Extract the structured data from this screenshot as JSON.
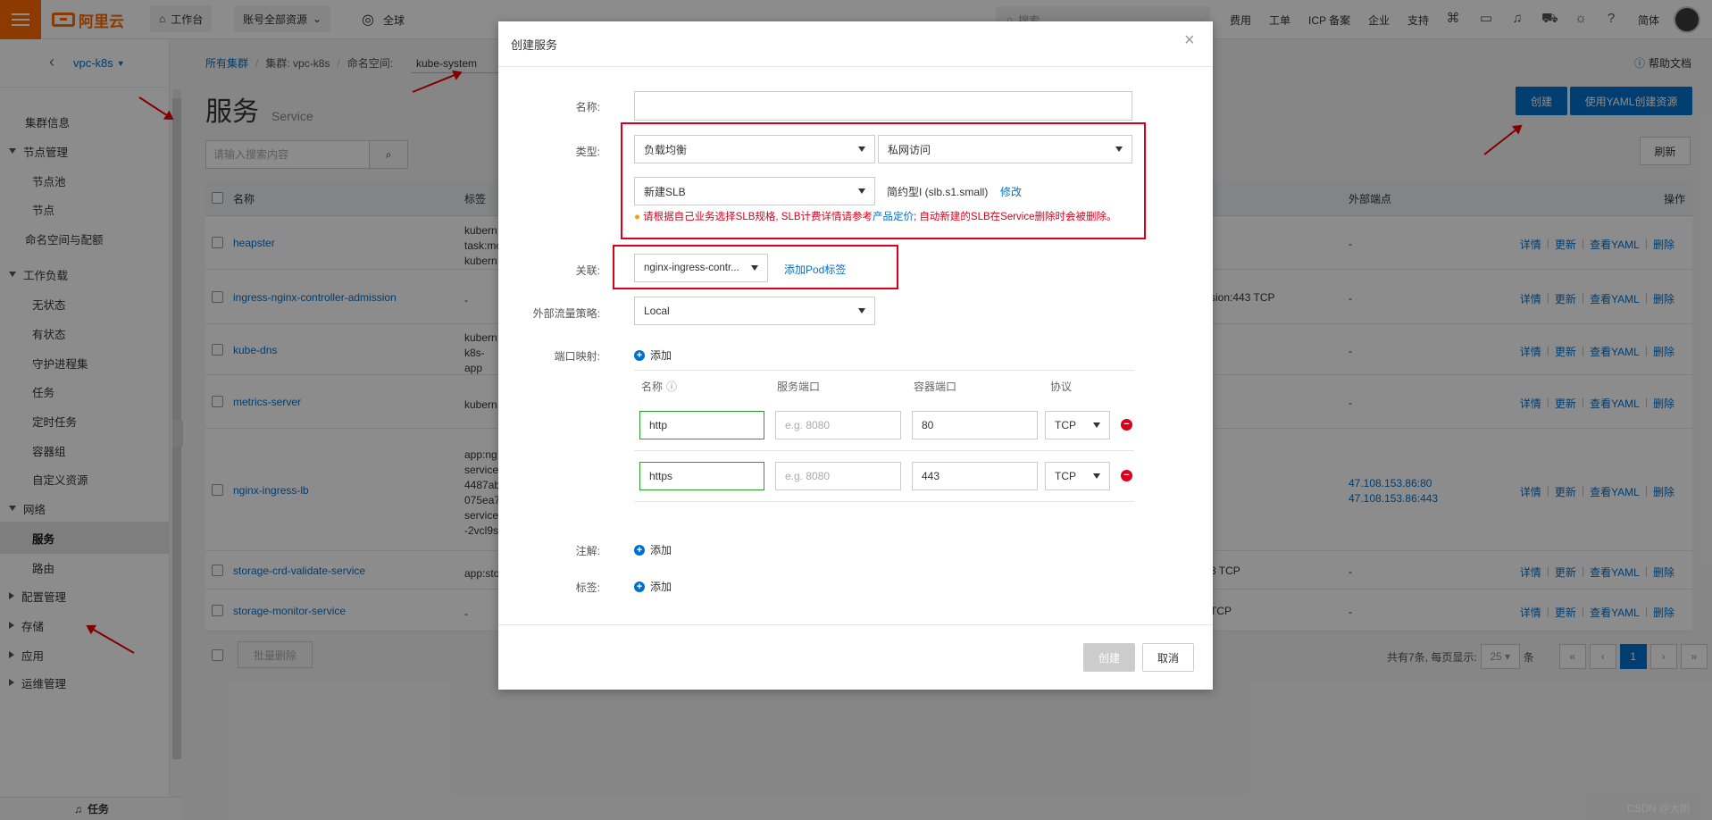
{
  "topbar": {
    "logo_text": "阿里云",
    "workbench": "工作台",
    "account_resources": "账号全部资源",
    "region": "全球",
    "search_placeholder": "搜索...",
    "links": [
      "费用",
      "工单",
      "ICP 备案",
      "企业",
      "支持"
    ],
    "language": "简体"
  },
  "sidebar": {
    "cluster_name": "vpc-k8s",
    "items": [
      {
        "label": "集群信息",
        "level": "l1"
      },
      {
        "label": "节点管理",
        "level": "grp",
        "expanded": true
      },
      {
        "label": "节点池",
        "level": "l2"
      },
      {
        "label": "节点",
        "level": "l2"
      },
      {
        "label": "命名空间与配额",
        "level": "l1"
      },
      {
        "label": "工作负载",
        "level": "grp",
        "expanded": true
      },
      {
        "label": "无状态",
        "level": "l2"
      },
      {
        "label": "有状态",
        "level": "l2"
      },
      {
        "label": "守护进程集",
        "level": "l2"
      },
      {
        "label": "任务",
        "level": "l2"
      },
      {
        "label": "定时任务",
        "level": "l2"
      },
      {
        "label": "容器组",
        "level": "l2"
      },
      {
        "label": "自定义资源",
        "level": "l2"
      },
      {
        "label": "网络",
        "level": "grp",
        "expanded": true
      },
      {
        "label": "服务",
        "level": "l2",
        "active": true
      },
      {
        "label": "路由",
        "level": "l2"
      },
      {
        "label": "配置管理",
        "level": "grp",
        "expanded": false
      },
      {
        "label": "存储",
        "level": "grp",
        "expanded": false
      },
      {
        "label": "应用",
        "level": "grp",
        "expanded": false
      },
      {
        "label": "运维管理",
        "level": "grp",
        "expanded": false
      }
    ],
    "task_label": "任务"
  },
  "main": {
    "breadcrumb": {
      "all_clusters": "所有集群",
      "cluster": "集群: vpc-k8s",
      "namespace_label": "命名空间:",
      "namespace_value": "kube-system"
    },
    "help_doc": "帮助文档",
    "title": "服务",
    "subtitle": "Service",
    "create_button": "创建",
    "yaml_button": "使用YAML创建资源",
    "search_placeholder": "请输入搜索内容",
    "refresh_button": "刷新",
    "columns": {
      "name": "名称",
      "labels": "标签",
      "external": "外部端点",
      "ops": "操作"
    },
    "rows": [
      {
        "name": "heapster",
        "labels": [
          "kubern",
          "task:mo",
          "kubern"
        ],
        "ports": "",
        "external": [
          "-"
        ]
      },
      {
        "name": "ingress-nginx-controller-admission",
        "labels": [
          "-"
        ],
        "ports": "sion:443 TCP",
        "external": [
          "-"
        ]
      },
      {
        "name": "kube-dns",
        "labels": [
          "kubern",
          "k8s-app",
          "kubern"
        ],
        "ports": "",
        "external": [
          "-"
        ]
      },
      {
        "name": "metrics-server",
        "labels": [
          "kubern"
        ],
        "ports": "",
        "external": [
          "-"
        ]
      },
      {
        "name": "nginx-ingress-lb",
        "labels": [
          "app:ng",
          "service.",
          "4487ab",
          "075ea7",
          "service.",
          "-2vcl9s"
        ],
        "ports": "",
        "external": [
          "47.108.153.86:80",
          "47.108.153.86:443"
        ]
      },
      {
        "name": "storage-crd-validate-service",
        "labels": [
          "app:sto"
        ],
        "ports": "3 TCP",
        "external": [
          "-"
        ]
      },
      {
        "name": "storage-monitor-service",
        "labels": [
          "-"
        ],
        "ports": "TCP",
        "external": [
          "-"
        ]
      }
    ],
    "row_ops": [
      "详情",
      "更新",
      "查看YAML",
      "删除"
    ],
    "batch_delete": "批量删除",
    "pager": {
      "summary": "共有7条, 每页显示:",
      "page_size": "25",
      "unit": "条",
      "current": "1"
    }
  },
  "modal": {
    "title": "创建服务",
    "name_label": "名称:",
    "name_value": "",
    "type_label": "类型:",
    "type_value": "负载均衡",
    "access_value": "私网访问",
    "slb_value": "新建SLB",
    "slb_spec": "简约型I (slb.s1.small)",
    "slb_modify": "修改",
    "warning_pre": "请根据自己业务选择SLB规格, SLB计费详情请参考",
    "warning_link": "产品定价",
    "warning_post": "; 自动新建的SLB在Service删除时会被删除。",
    "assoc_label": "关联:",
    "assoc_value": "nginx-ingress-contr...",
    "add_pod_label": "添加Pod标签",
    "traffic_label": "外部流量策略:",
    "traffic_value": "Local",
    "port_label": "端口映射:",
    "add_text": "添加",
    "port_cols": {
      "name": "名称",
      "svc_port": "服务端口",
      "container_port": "容器端口",
      "protocol": "协议"
    },
    "ports": [
      {
        "name": "http",
        "svc_port_placeholder": "e.g. 8080",
        "container_port": "80",
        "protocol": "TCP"
      },
      {
        "name": "https",
        "svc_port_placeholder": "e.g. 8080",
        "container_port": "443",
        "protocol": "TCP"
      }
    ],
    "annotation_label": "注解:",
    "tag_label": "标签:",
    "create_button": "创建",
    "cancel_button": "取消"
  },
  "watermark": "CSDN @大阴",
  "colors": {
    "brand": "#ff6a00",
    "primary": "#0070cc",
    "highlight": "#d9001b"
  }
}
